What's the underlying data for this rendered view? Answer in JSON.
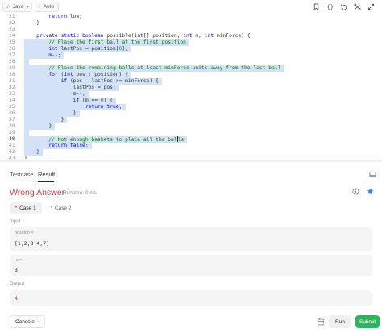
{
  "toolbar": {
    "language": "Java",
    "mode": "Auto"
  },
  "editor": {
    "lines": [
      {
        "n": "21",
        "text": "        return low;",
        "hl": false
      },
      {
        "n": "22",
        "text": "    }",
        "hl": false
      },
      {
        "n": "23",
        "text": "",
        "hl": false
      },
      {
        "n": "24",
        "text": "    private static boolean possible(int[] position, int m, int minForce) {",
        "hl": false
      },
      {
        "n": "25",
        "text": "        // Place the first ball at the first position",
        "hl": true
      },
      {
        "n": "26",
        "text": "        int lastPos = position[0];",
        "hl": true
      },
      {
        "n": "27",
        "text": "        m--;",
        "hl": true
      },
      {
        "n": "28",
        "text": "",
        "hl": true
      },
      {
        "n": "29",
        "text": "        // Place the remaining balls at least minForce units away from the last ball",
        "hl": true
      },
      {
        "n": "30",
        "text": "        for (int pos : position) {",
        "hl": true
      },
      {
        "n": "31",
        "text": "            if (pos - lastPos >= minForce) {",
        "hl": true
      },
      {
        "n": "32",
        "text": "                lastPos = pos;",
        "hl": true
      },
      {
        "n": "33",
        "text": "                m--;",
        "hl": true
      },
      {
        "n": "34",
        "text": "                if (m == 0) {",
        "hl": true
      },
      {
        "n": "35",
        "text": "                    return true;",
        "hl": true
      },
      {
        "n": "36",
        "text": "                }",
        "hl": true
      },
      {
        "n": "37",
        "text": "            }",
        "hl": true
      },
      {
        "n": "38",
        "text": "        }",
        "hl": true
      },
      {
        "n": "39",
        "text": "",
        "hl": true
      },
      {
        "n": "40",
        "text": "        // Not enough baskets to place all the balls",
        "hl": true
      },
      {
        "n": "41",
        "text": "        return false;",
        "hl": true
      },
      {
        "n": "42",
        "text": "    }",
        "hl": true
      },
      {
        "n": "43",
        "text": "}",
        "hl": false
      }
    ]
  },
  "tabs": {
    "testcase": "Testcase",
    "result": "Result"
  },
  "result": {
    "verdict": "Wrong Answer",
    "runtime": "Runtime: 0 ms",
    "verdict_color": "#d9363e"
  },
  "cases": {
    "case1": "Case 1",
    "case2": "Case 2"
  },
  "input": {
    "label": "Input",
    "vars": [
      {
        "name": "position =",
        "value": "[1,2,3,4,7]"
      },
      {
        "name": "m =",
        "value": "3"
      }
    ]
  },
  "output": {
    "label": "Output",
    "value": "4"
  },
  "footer": {
    "console": "Console",
    "run": "Run",
    "submit": "Submit",
    "submit_color": "#2db55d"
  },
  "icons": [
    "chevron-down-icon",
    "bookmark-icon",
    "braces-icon",
    "undo-icon",
    "settings-icon",
    "expand-icon",
    "panel-icon",
    "info-icon",
    "debug-icon",
    "upload-icon"
  ]
}
